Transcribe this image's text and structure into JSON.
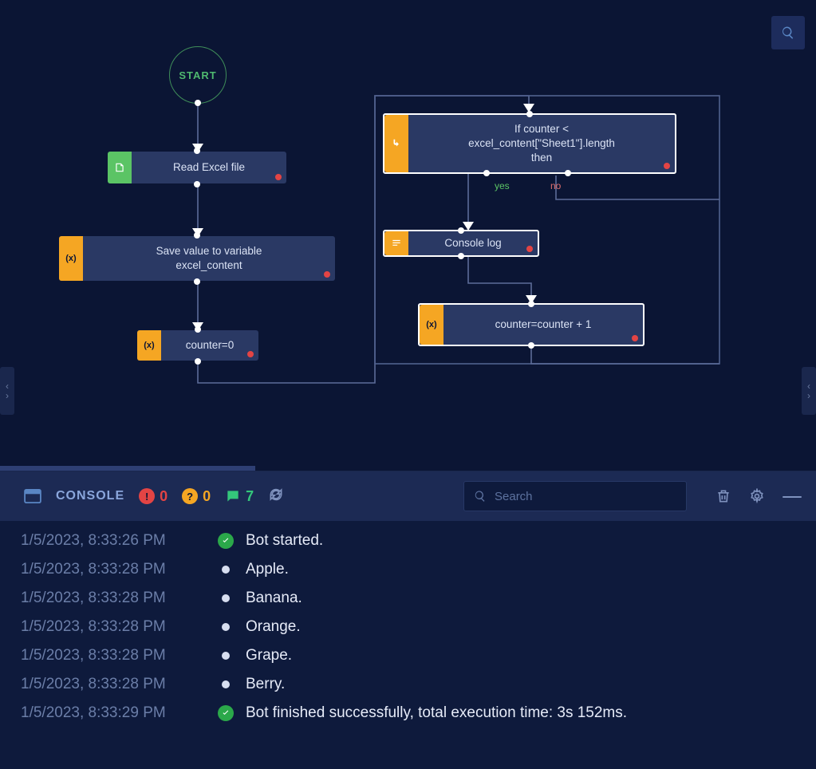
{
  "flow": {
    "start": {
      "label": "START"
    },
    "nodes": {
      "read_excel": {
        "label": "Read Excel file"
      },
      "save_var": {
        "label": "Save value to variable\nexcel_content"
      },
      "counter_init": {
        "label": "counter=0"
      },
      "if_cond": {
        "label": "If counter <\nexcel_content[\"Sheet1\"].length\nthen"
      },
      "console_log": {
        "label": "Console log"
      },
      "counter_inc": {
        "label": "counter=counter + 1"
      }
    },
    "edges": {
      "yes": "yes",
      "no": "no"
    }
  },
  "console": {
    "title": "CONSOLE",
    "badges": {
      "error": "0",
      "warn": "0",
      "msg": "7"
    },
    "search_placeholder": "Search",
    "log": [
      {
        "ts": "1/5/2023, 8:33:26 PM",
        "status": "ok",
        "msg": "Bot started."
      },
      {
        "ts": "1/5/2023, 8:33:28 PM",
        "status": "dot",
        "msg": "Apple."
      },
      {
        "ts": "1/5/2023, 8:33:28 PM",
        "status": "dot",
        "msg": "Banana."
      },
      {
        "ts": "1/5/2023, 8:33:28 PM",
        "status": "dot",
        "msg": "Orange."
      },
      {
        "ts": "1/5/2023, 8:33:28 PM",
        "status": "dot",
        "msg": "Grape."
      },
      {
        "ts": "1/5/2023, 8:33:28 PM",
        "status": "dot",
        "msg": "Berry."
      },
      {
        "ts": "1/5/2023, 8:33:29 PM",
        "status": "ok",
        "msg": "Bot finished successfully, total execution time: 3s 152ms."
      }
    ]
  }
}
